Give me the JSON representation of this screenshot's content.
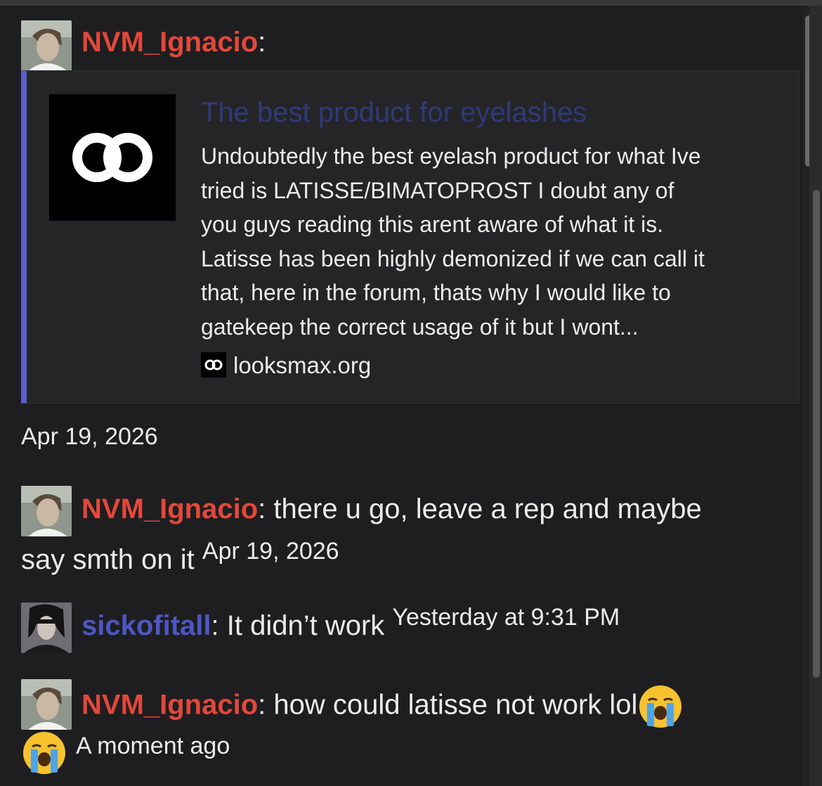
{
  "messages": [
    {
      "username": "NVM_Ignacio",
      "separator": ":",
      "embed": {
        "title": "The best product for eyelashes",
        "description_lines": [
          "Undoubtedly the best eyelash product for what Ive",
          "tried is LATISSE/BIMATOPROST I doubt any of",
          "you guys reading this arent aware of what it is.",
          "Latisse has been highly demonized if we can call it",
          "that, here in the forum, thats why I would like to",
          "gatekeep the correct usage of it but I wont..."
        ],
        "site": "looksmax.org"
      },
      "timestamp": "Apr 19, 2026"
    },
    {
      "username": "NVM_Ignacio",
      "separator": ":",
      "text_line1": " there u go, leave a rep and maybe",
      "text_line2": "say smth on it",
      "timestamp": "Apr 19, 2026"
    },
    {
      "username": "sickofitall",
      "separator": ":",
      "text": " It didn’t work",
      "timestamp": "Yesterday at 9:31 PM"
    },
    {
      "username": "NVM_Ignacio",
      "separator": ":",
      "text": " how could latisse not work lol",
      "emoji": "loudly-crying-face",
      "timestamp": "A moment ago"
    }
  ],
  "colors": {
    "background": "#1e1e20",
    "username_red": "#e2483a",
    "username_blue": "#4c56c4",
    "embed_border": "#5a60c8",
    "embed_title": "#2f3a7a"
  }
}
